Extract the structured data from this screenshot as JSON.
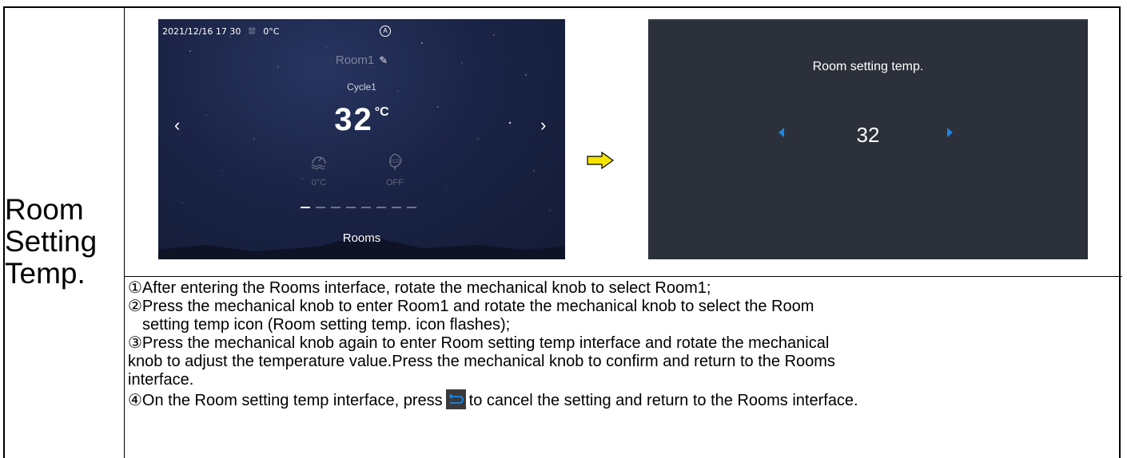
{
  "left_label": {
    "line1": "Room",
    "line2": "Setting",
    "line3": "Temp."
  },
  "screen1": {
    "status_date": "2021/12/16 17 30",
    "status_temp": "0°C",
    "room_name": "Room1",
    "cycle": "Cycle1",
    "temperature": "32",
    "temperature_unit": "°C",
    "mini_left_value": "0°C",
    "mini_right_value": "OFF",
    "mini_right_icon_text": "ECO",
    "footer": "Rooms",
    "nav_left": "‹",
    "nav_right": "›",
    "page_count": 8,
    "active_page": 1
  },
  "screen2": {
    "title": "Room setting temp.",
    "value": "32"
  },
  "steps": {
    "step1": "①After entering the Rooms interface, rotate the mechanical knob to select Room1;",
    "step2_line1": "②Press the mechanical knob to enter Room1 and rotate the mechanical knob to select the Room",
    "step2_line2": "setting temp icon (Room setting temp. icon flashes);",
    "step3_line1": "③Press the mechanical knob again to enter Room setting temp interface and rotate the mechanical",
    "step3_line2": "knob to adjust the temperature value.Press the mechanical knob to confirm and return to the Rooms",
    "step3_line3": "interface.",
    "step4_before": "④On the Room setting temp interface, press",
    "step4_after": "to cancel the setting and return to the Rooms interface."
  },
  "colors": {
    "accent_blue": "#1b87e6",
    "arrow_yellow": "#f5e400",
    "screen2_bg": "#2b303a",
    "screen1_bg": "#1b2447"
  }
}
